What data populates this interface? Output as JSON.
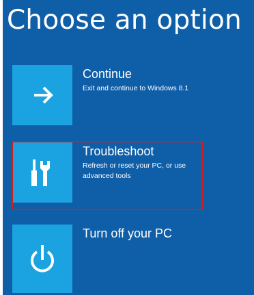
{
  "page": {
    "title": "Choose an option"
  },
  "options": [
    {
      "label": "Continue",
      "description": "Exit and continue to Windows 8.1",
      "icon": "arrow-right-icon"
    },
    {
      "label": "Troubleshoot",
      "description": "Refresh or reset your PC, or use advanced tools",
      "icon": "tools-icon"
    },
    {
      "label": "Turn off your PC",
      "description": "",
      "icon": "power-icon"
    }
  ],
  "colors": {
    "background": "#0f5ea8",
    "tile": "#1aa3e0",
    "text": "#ffffff",
    "highlight": "#d0201e"
  }
}
